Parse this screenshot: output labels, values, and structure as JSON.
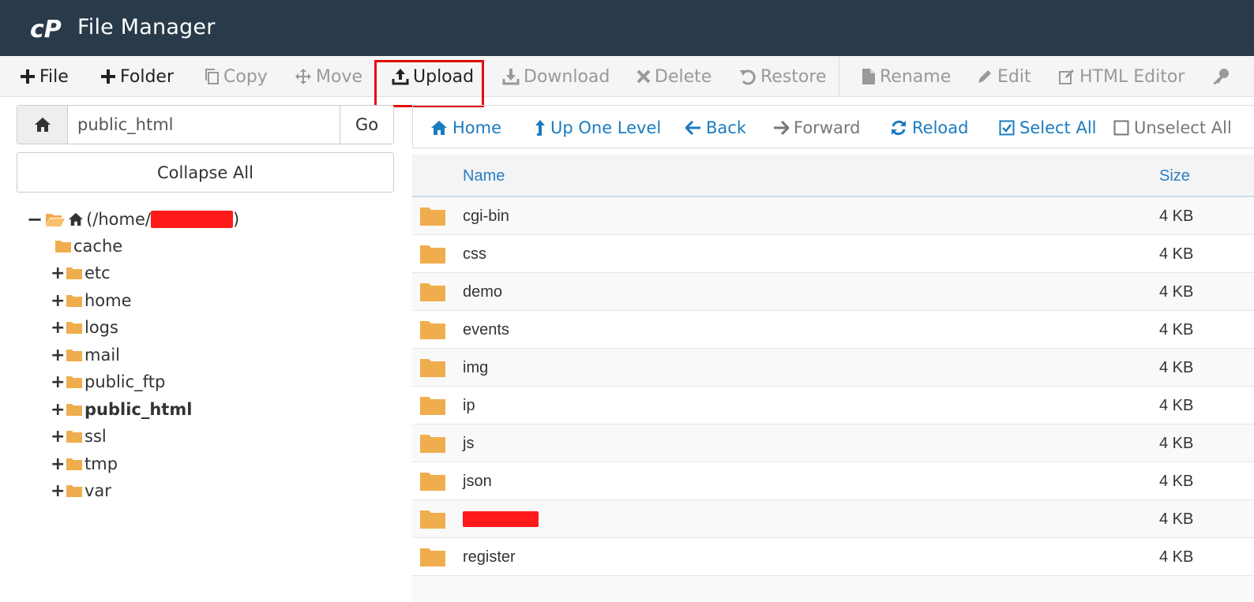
{
  "app": {
    "title": "File Manager"
  },
  "toolbar": {
    "file": "File",
    "folder": "Folder",
    "copy": "Copy",
    "move": "Move",
    "upload": "Upload",
    "download": "Download",
    "delete": "Delete",
    "restore": "Restore",
    "rename": "Rename",
    "edit": "Edit",
    "html_editor": "HTML Editor"
  },
  "path": {
    "value": "public_html",
    "go_label": "Go"
  },
  "tree": {
    "collapse_label": "Collapse All",
    "root_prefix": "(/home/",
    "root_suffix": ")",
    "items": [
      {
        "label": "cache",
        "toggle": ""
      },
      {
        "label": "etc",
        "toggle": "+"
      },
      {
        "label": "home",
        "toggle": "+"
      },
      {
        "label": "logs",
        "toggle": "+"
      },
      {
        "label": "mail",
        "toggle": "+"
      },
      {
        "label": "public_ftp",
        "toggle": "+"
      },
      {
        "label": "public_html",
        "toggle": "+"
      },
      {
        "label": "ssl",
        "toggle": "+"
      },
      {
        "label": "tmp",
        "toggle": "+"
      },
      {
        "label": "var",
        "toggle": "+"
      }
    ]
  },
  "nav": {
    "home": "Home",
    "up": "Up One Level",
    "back": "Back",
    "forward": "Forward",
    "reload": "Reload",
    "select_all": "Select All",
    "unselect_all": "Unselect All"
  },
  "table": {
    "headers": {
      "name": "Name",
      "size": "Size"
    },
    "rows": [
      {
        "name": "cgi-bin",
        "size": "4 KB"
      },
      {
        "name": "css",
        "size": "4 KB"
      },
      {
        "name": "demo",
        "size": "4 KB"
      },
      {
        "name": "events",
        "size": "4 KB"
      },
      {
        "name": "img",
        "size": "4 KB"
      },
      {
        "name": "ip",
        "size": "4 KB"
      },
      {
        "name": "js",
        "size": "4 KB"
      },
      {
        "name": "json",
        "size": "4 KB"
      },
      {
        "name": "",
        "size": "4 KB"
      },
      {
        "name": "register",
        "size": "4 KB"
      }
    ]
  },
  "colors": {
    "titlebar": "#293a4a",
    "folder": "#f0ad4e",
    "link": "#1b7bbf",
    "highlight": "#e01010",
    "redaction": "#ff1a1a"
  }
}
